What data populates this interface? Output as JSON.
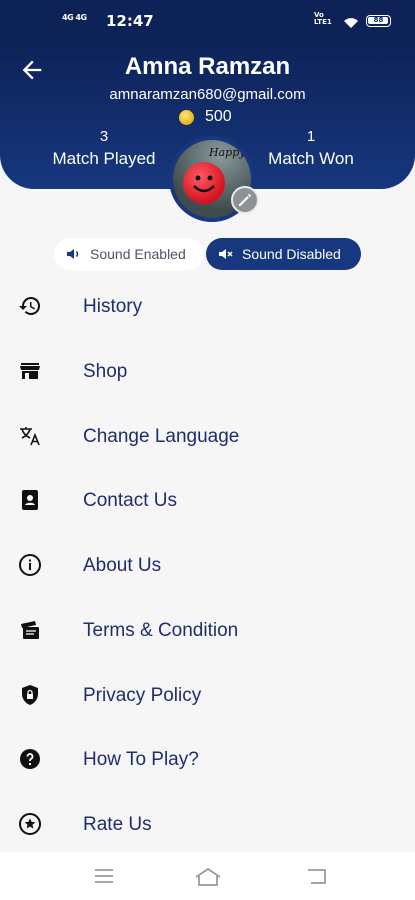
{
  "status_bar": {
    "signal": "4G 4G",
    "time": "12:47",
    "network": "Vo LTE1",
    "battery": "88"
  },
  "profile": {
    "name": "Amna Ramzan",
    "email": "amnaramzan680@gmail.com",
    "coins": "500",
    "matches_played": {
      "value": "3",
      "label": "Match Played"
    },
    "matches_won": {
      "value": "1",
      "label": "Match Won"
    },
    "avatar_text": "Happy"
  },
  "sound": {
    "enabled_label": "Sound Enabled",
    "disabled_label": "Sound Disabled",
    "selected": "Sound Disabled"
  },
  "menu": {
    "items": [
      {
        "label": "History",
        "icon": "history-icon"
      },
      {
        "label": "Shop",
        "icon": "shop-icon"
      },
      {
        "label": "Change Language",
        "icon": "translate-icon"
      },
      {
        "label": "Contact Us",
        "icon": "contact-icon"
      },
      {
        "label": "About Us",
        "icon": "info-icon"
      },
      {
        "label": "Terms & Condition",
        "icon": "terms-icon"
      },
      {
        "label": "Privacy Policy",
        "icon": "shield-lock-icon"
      },
      {
        "label": "How To Play?",
        "icon": "help-icon"
      },
      {
        "label": "Rate Us",
        "icon": "star-icon"
      }
    ]
  },
  "colors": {
    "header": "#0d2257",
    "accent": "#17377e",
    "menu_text": "#1f2e6b"
  }
}
